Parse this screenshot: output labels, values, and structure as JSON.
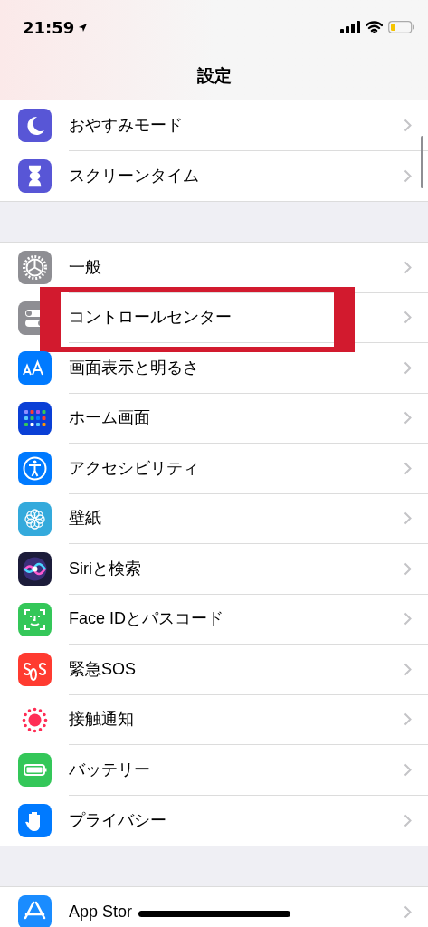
{
  "status_bar": {
    "time": "21:59"
  },
  "nav": {
    "title": "設定"
  },
  "groups": [
    {
      "items": [
        {
          "label": "おやすみモード",
          "highlighted": false
        },
        {
          "label": "スクリーンタイム",
          "highlighted": false
        }
      ]
    },
    {
      "items": [
        {
          "label": "一般",
          "highlighted": false
        },
        {
          "label": "コントロールセンター",
          "highlighted": true
        },
        {
          "label": "画面表示と明るさ",
          "highlighted": false
        },
        {
          "label": "ホーム画面",
          "highlighted": false
        },
        {
          "label": "アクセシビリティ",
          "highlighted": false
        },
        {
          "label": "壁紙",
          "highlighted": false
        },
        {
          "label": "Siriと検索",
          "highlighted": false
        },
        {
          "label": "Face IDとパスコード",
          "highlighted": false
        },
        {
          "label": "緊急SOS",
          "highlighted": false
        },
        {
          "label": "接触通知",
          "highlighted": false
        },
        {
          "label": "バッテリー",
          "highlighted": false
        },
        {
          "label": "プライバシー",
          "highlighted": false
        }
      ]
    },
    {
      "items": [
        {
          "label": "App Stor",
          "highlighted": false
        }
      ]
    }
  ]
}
